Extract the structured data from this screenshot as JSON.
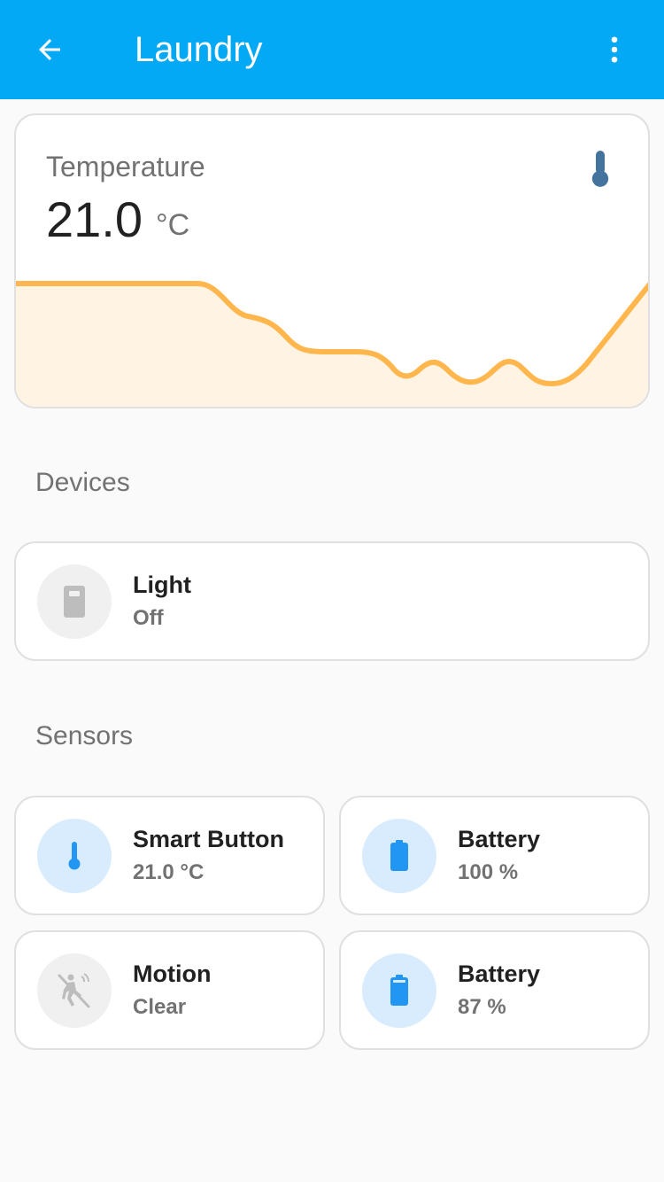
{
  "header": {
    "title": "Laundry",
    "back_icon": "arrow-left-icon",
    "menu_icon": "dots-vertical-icon",
    "color": "#03a9f4"
  },
  "temperature_card": {
    "name": "Temperature",
    "value": "21.0",
    "unit": "°C",
    "icon": "thermometer-icon",
    "icon_color": "#44739e",
    "line_color": "#ffb74d"
  },
  "devices": {
    "title": "Devices",
    "items": [
      {
        "name": "Light",
        "state": "Off",
        "icon": "light-switch-icon"
      }
    ]
  },
  "sensors": {
    "title": "Sensors",
    "items": [
      {
        "name": "Smart Button",
        "state": "21.0 °C",
        "icon": "thermometer-icon"
      },
      {
        "name": "Battery",
        "state": "100 %",
        "icon": "battery-full-icon"
      },
      {
        "name": "Motion",
        "state": "Clear",
        "icon": "motion-sensor-off-icon"
      },
      {
        "name": "Battery",
        "state": "87 %",
        "icon": "battery-high-icon"
      }
    ],
    "active_color": "#2196f3",
    "inactive_color": "#bdbdbd"
  }
}
